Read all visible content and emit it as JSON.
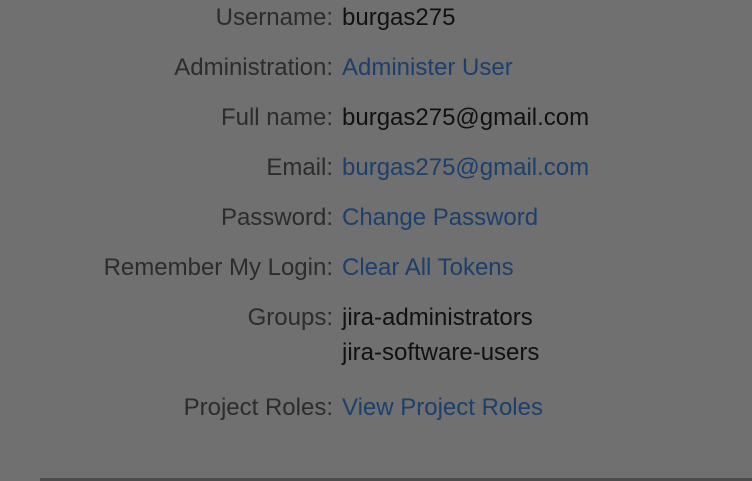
{
  "profile": {
    "username": {
      "label": "Username:",
      "value": "burgas275"
    },
    "administration": {
      "label": "Administration:",
      "value": "Administer User"
    },
    "full_name": {
      "label": "Full name:",
      "value": "burgas275@gmail.com"
    },
    "email": {
      "label": "Email:",
      "value": "burgas275@gmail.com"
    },
    "password": {
      "label": "Password:",
      "value": "Change Password"
    },
    "remember_login": {
      "label": "Remember My Login:",
      "value": "Clear All Tokens"
    },
    "groups": {
      "label": "Groups:",
      "values": [
        "jira-administrators",
        "jira-software-users"
      ]
    },
    "project_roles": {
      "label": "Project Roles:",
      "value": "View Project Roles"
    }
  },
  "colors": {
    "overlay_background": "#707070",
    "label_text": "#2c2c2c",
    "value_text": "#111111",
    "link_text": "#1c3f6b"
  }
}
